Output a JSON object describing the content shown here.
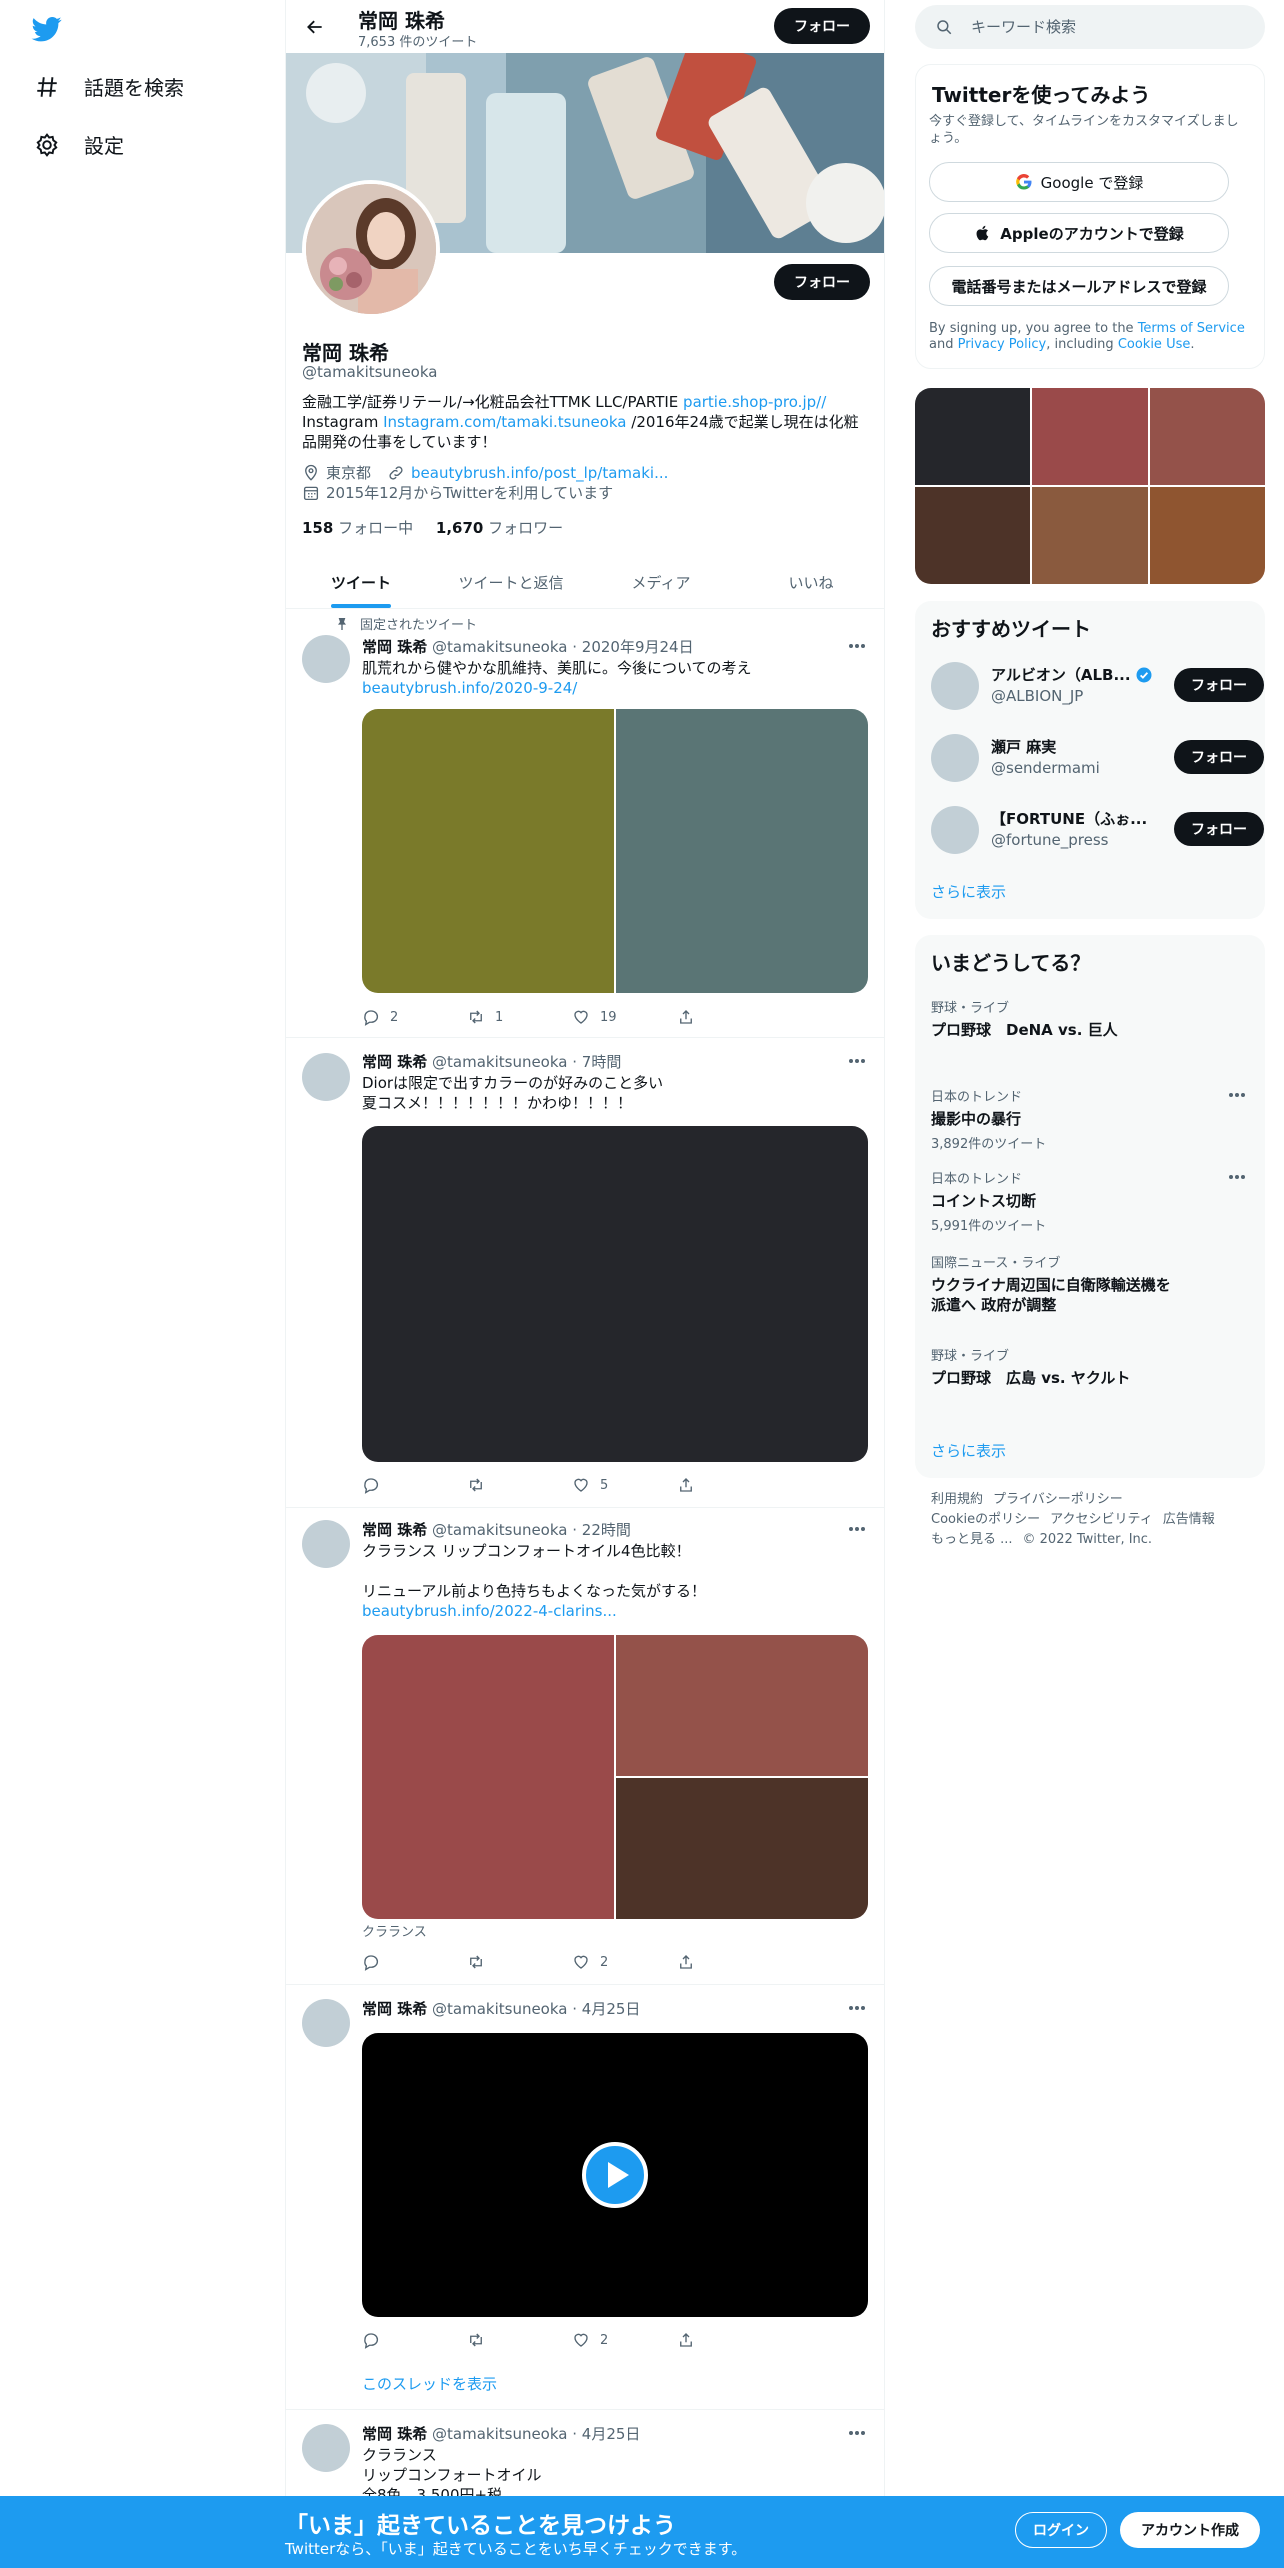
{
  "nav": {
    "logo_icon": "twitter-bird-icon",
    "explore_label": "話題を検索",
    "settings_label": "設定"
  },
  "header": {
    "name": "常岡 珠希",
    "tweet_count": "7,653 件のツイート",
    "follow_label": "フォロー"
  },
  "profile": {
    "name": "常岡 珠希",
    "handle": "@tamakitsuneoka",
    "follow_label": "フォロー",
    "bio_line1_text": "金融工学/証券リテール/→化粧品会社TTMK LLC/PARTIE ",
    "bio_line1_link": "partie.shop-pro.jp//",
    "bio_line2_prefix": "Instagram ",
    "bio_line2_link": "Instagram.com/tamaki.tsuneoka",
    "bio_line2_suffix": " /2016年24歳で起業し現在は化粧品開発の仕事をしています！",
    "location": "東京都",
    "website": "beautybrush.info/post_lp/tamaki...",
    "joined": "2015年12月からTwitterを利用しています",
    "following_count": "158",
    "following_label": "フォロー中",
    "followers_count": "1,670",
    "followers_label": "フォロワー"
  },
  "tabs": [
    {
      "label": "ツイート",
      "active": true
    },
    {
      "label": "ツイートと返信",
      "active": false
    },
    {
      "label": "メディア",
      "active": false
    },
    {
      "label": "いいね",
      "active": false
    }
  ],
  "pinned_label": "固定されたツイート",
  "tweets": [
    {
      "name": "常岡 珠希",
      "handle": "@tamakitsuneoka",
      "time": "2020年9月24日",
      "text": "肌荒れから健やかな肌維持、美肌に。今後についての考え",
      "link": "beautybrush.info/2020-9-24/",
      "replies": "2",
      "retweets": "1",
      "likes": "19",
      "media_colors": [
        "#7a7a2a",
        "#5a7575"
      ]
    },
    {
      "name": "常岡 珠希",
      "handle": "@tamakitsuneoka",
      "time": "7時間",
      "text": "Diorは限定で出すカラーのが好みのこと多い\n夏コスメ！！！！！！！かわゆ！！！！",
      "replies": "",
      "retweets": "",
      "likes": "5",
      "media_colors": [
        "#25262b"
      ]
    },
    {
      "name": "常岡 珠希",
      "handle": "@tamakitsuneoka",
      "time": "22時間",
      "text": "クラランス リップコンフォートオイル4色比較！\n\nリニューアル前より色持ちもよくなった気がする！",
      "link": "beautybrush.info/2022-4-clarins...",
      "caption": "クラランス",
      "replies": "",
      "retweets": "",
      "likes": "2",
      "media_colors": [
        "#9a4a4a",
        "#94524a",
        "#4d3328"
      ]
    },
    {
      "name": "常岡 珠希",
      "handle": "@tamakitsuneoka",
      "time": "4月25日",
      "replies": "",
      "retweets": "",
      "likes": "2",
      "thread_label": "このスレッドを表示",
      "media_colors": [
        "#000000"
      ]
    },
    {
      "name": "常岡 珠希",
      "handle": "@tamakitsuneoka",
      "time": "4月25日",
      "text": "クラランス\nリップコンフォートオイル\n全8色　3,500円+税"
    }
  ],
  "right": {
    "search_placeholder": "キーワード検索",
    "signup": {
      "title": "Twitterを使ってみよう",
      "subtitle": "今すぐ登録して、タイムラインをカスタマイズしましょう。",
      "google_label": "Google で登録",
      "apple_label": "Appleのアカウントで登録",
      "phone_label": "電話番号またはメールアドレスで登録",
      "tos_prefix": "By signing up, you agree to the ",
      "tos_link1": "Terms of Service",
      "tos_and": " and ",
      "tos_link2": "Privacy Policy",
      "tos_including": ", including ",
      "tos_link3": "Cookie Use",
      "tos_end": "."
    },
    "photo_colors": [
      "#25262b",
      "#9a4a4a",
      "#94524a",
      "#4d3328",
      "#8a5a3e",
      "#8f5530"
    ],
    "recommend": {
      "title": "おすすめツイート",
      "follow_label": "フォロー",
      "accounts": [
        {
          "name": "アルビオン（ALB...",
          "handle": "@ALBION_JP",
          "verified": true
        },
        {
          "name": "瀬戸 麻実",
          "handle": "@sendermami",
          "verified": false
        },
        {
          "name": "【FORTUNE（ふぉ...",
          "handle": "@fortune_press",
          "verified": false
        }
      ],
      "show_more": "さらに表示"
    },
    "trends": {
      "title": "いまどうしてる？",
      "items": [
        {
          "context": "野球・ライブ",
          "title": "プロ野球　DeNA vs. 巨人",
          "count": "",
          "more": false
        },
        {
          "context": "日本のトレンド",
          "title": "撮影中の暴行",
          "count": "3,892件のツイート",
          "more": true
        },
        {
          "context": "日本のトレンド",
          "title": "コイントス切断",
          "count": "5,991件のツイート",
          "more": true
        },
        {
          "context": "国際ニュース・ライブ",
          "title": "ウクライナ周辺国に自衛隊輸送機を派遣へ 政府が調整",
          "count": "",
          "more": false
        },
        {
          "context": "野球・ライブ",
          "title": "プロ野球　広島 vs. ヤクルト",
          "count": "",
          "more": false
        }
      ],
      "show_more": "さらに表示"
    },
    "footer": {
      "terms": "利用規約",
      "privacy": "プライバシーポリシー",
      "cookie": "Cookieのポリシー",
      "accessibility": "アクセシビリティ",
      "ads": "広告情報",
      "more": "もっと見る ...",
      "copyright": "© 2022 Twitter, Inc."
    }
  },
  "bottom_bar": {
    "title": "「いま」起きていることを見つけよう",
    "subtitle": "Twitterなら、「いま」起きていることをいち早くチェックできます。",
    "login_label": "ログイン",
    "signup_label": "アカウント作成"
  }
}
